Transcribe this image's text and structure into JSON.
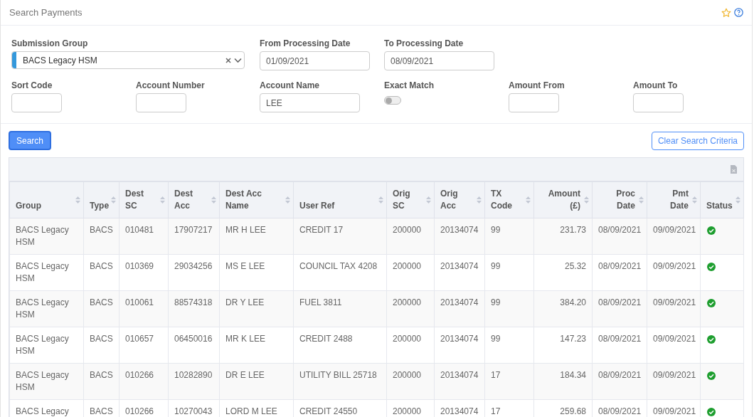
{
  "header": {
    "title": "Search Payments",
    "favourite": false
  },
  "filters": {
    "submission_group": {
      "label": "Submission Group",
      "value": "BACS Legacy HSM"
    },
    "from_date": {
      "label": "From Processing Date",
      "value": "01/09/2021"
    },
    "to_date": {
      "label": "To Processing Date",
      "value": "08/09/2021"
    },
    "sort_code": {
      "label": "Sort Code"
    },
    "account_number": {
      "label": "Account Number"
    },
    "account_name": {
      "label": "Account Name",
      "value": "LEE"
    },
    "exact_match": {
      "label": "Exact Match",
      "on": false
    },
    "amount_from": {
      "label": "Amount From"
    },
    "amount_to": {
      "label": "Amount To"
    }
  },
  "buttons": {
    "search": "Search",
    "clear": "Clear Search Criteria"
  },
  "table": {
    "columns": [
      {
        "label": "Group"
      },
      {
        "label": "Type"
      },
      {
        "label": "Dest SC"
      },
      {
        "label": "Dest Acc"
      },
      {
        "label": "Dest Acc Name"
      },
      {
        "label": "User Ref"
      },
      {
        "label": "Orig SC"
      },
      {
        "label": "Orig Acc"
      },
      {
        "label": "TX Code"
      },
      {
        "label": "Amount (£)"
      },
      {
        "label": "Proc Date"
      },
      {
        "label": "Pmt Date"
      },
      {
        "label": "Status"
      }
    ],
    "rows": [
      {
        "cells": [
          "BACS Legacy HSM",
          "BACS",
          "010481",
          "17907217",
          "MR H LEE",
          "CREDIT 17",
          "200000",
          "20134074",
          "99",
          "231.73",
          "08/09/2021",
          "09/09/2021"
        ],
        "succeeded": true
      },
      {
        "cells": [
          "BACS Legacy HSM",
          "BACS",
          "010369",
          "29034256",
          "MS E LEE",
          "COUNCIL TAX 4208",
          "200000",
          "20134074",
          "99",
          "25.32",
          "08/09/2021",
          "09/09/2021"
        ],
        "succeeded": true
      },
      {
        "cells": [
          "BACS Legacy HSM",
          "BACS",
          "010061",
          "88574318",
          "DR Y LEE",
          "FUEL 3811",
          "200000",
          "20134074",
          "99",
          "384.20",
          "08/09/2021",
          "09/09/2021"
        ],
        "succeeded": true
      },
      {
        "cells": [
          "BACS Legacy HSM",
          "BACS",
          "010657",
          "06450016",
          "MR K LEE",
          "CREDIT 2488",
          "200000",
          "20134074",
          "99",
          "147.23",
          "08/09/2021",
          "09/09/2021"
        ],
        "succeeded": true
      },
      {
        "cells": [
          "BACS Legacy HSM",
          "BACS",
          "010266",
          "10282890",
          "DR E LEE",
          "UTILITY BILL 25718",
          "200000",
          "20134074",
          "17",
          "184.34",
          "08/09/2021",
          "09/09/2021"
        ],
        "succeeded": true
      },
      {
        "cells": [
          "BACS Legacy",
          "BACS",
          "010266",
          "10270043",
          "LORD M LEE",
          "CREDIT 24550",
          "200000",
          "20134074",
          "17",
          "259.68",
          "08/09/2021",
          "09/09/2021"
        ],
        "succeeded": true
      }
    ]
  }
}
